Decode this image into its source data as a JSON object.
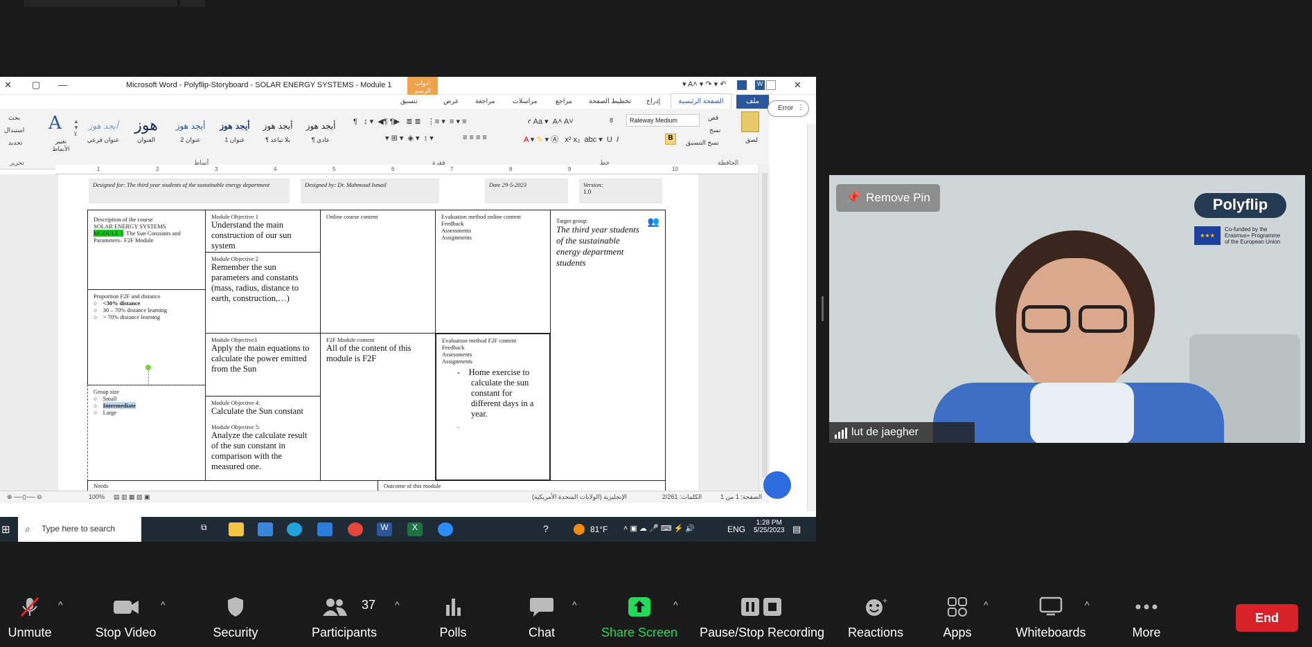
{
  "word": {
    "title": "Microsoft Word - Polyflip-Storyboard - SOLAR ENERGY SYSTEMS - Module 1",
    "tools_tab": "أدوات الرسم",
    "format_tab": "تنسيق",
    "tabs": [
      "ملف",
      "الصفحة الرئيسية",
      "إدراج",
      "تخطيط الصفحة",
      "مراجع",
      "مراسلات",
      "مراجعة",
      "عرض"
    ],
    "error_button": "Error",
    "font_name": "Raleway Medium",
    "font_size": "8",
    "group_labels": {
      "clipboard": "الحافظة",
      "font": "خط",
      "paragraph": "فقرة",
      "styles": "أنماط",
      "editing": "تحرير"
    },
    "clipboard_items": [
      "قص",
      "نسخ",
      "نسخ التنسيق",
      "لصق"
    ],
    "editing_items": [
      "بحث",
      "استبدال",
      "تحديد"
    ],
    "change_styles": "تغيير الأنماط",
    "styles": [
      {
        "sample": "أيجد هوز",
        "name": "¶ عادي"
      },
      {
        "sample": "أيجد هوز",
        "name": "¶ بلا تباعد"
      },
      {
        "sample": "أيجد هوز",
        "name": "عنوان 1"
      },
      {
        "sample": "أيجد هوز",
        "name": "عنوان 2"
      },
      {
        "sample": "هوز",
        "name": "العنوان"
      },
      {
        "sample": "أيجد هوز",
        "name": "عنوان فرعي"
      }
    ],
    "ruler_numbers": [
      "1",
      "2",
      "3",
      "4",
      "5",
      "6",
      "7",
      "8",
      "9",
      "10"
    ],
    "status": {
      "page": "الصفحة: 1 من 1",
      "words": "الكلمات: 2/261",
      "language": "الإنجليزية (الولايات المتحدة الأمريكية)",
      "zoom": "100%"
    }
  },
  "doc": {
    "header": {
      "designed_for": "Designed for: The third year students of the sustainable energy department",
      "designed_by": "Designed by: Dr. Mahmoud Ismail",
      "date": "Date 29-5-2023",
      "version_label": "Version:",
      "version_value": "1.0"
    },
    "description_title": "Description of the course",
    "description_line1": "SOLAR ENERGY SYSTEMS",
    "module_label": "MODULE 1",
    "description_rest": ": The Sun Constants and Parameters– F2F Module",
    "proportion_title": "Proportion F2F and distance",
    "proportion_items": [
      "<30% distance",
      "30 – 70% distance learning",
      "> 70% distance learning"
    ],
    "group_size_title": "Group size",
    "group_size_items": [
      "Small",
      "Intermediate",
      "Large"
    ],
    "objective1_label": "Module Objective 1",
    "objective1": "Understand the main construction of our sun system",
    "objective2_label": "Module Objective 2",
    "objective2": "Remember the sun parameters and constants (mass, radius, distance to earth, construction,…)",
    "objective3_label": "Module Objective3",
    "objective3": "Apply the main equations to calculate the power emitted from the Sun",
    "objective4_label": "Module Objective 4:",
    "objective4": "Calculate the Sun constant",
    "objective5_label": "Module Objective 5:",
    "objective5": "Analyze the calculate result of the sun constant in comparison with the measured one.",
    "online_content": "Online course content",
    "f2f_content_label": "F2F Module content",
    "f2f_content": "All of the content of this module is F2F",
    "eval_online": "Evaluation method online content",
    "eval_online_items": [
      "Feedback",
      "Assessments",
      "Assignments"
    ],
    "eval_f2f": "Evaluation method F2F content",
    "eval_f2f_items": [
      "Feedback",
      "Assessments",
      "Assignments"
    ],
    "home_exercise": "Home exercise to calculate the sun constant for different days in a year.",
    "target_label": "Target group:",
    "target": "The third year students of the sustainable energy department students",
    "needs": "Needs",
    "outcome": "Outcome of this module"
  },
  "taskbar": {
    "search_placeholder": "Type here to search",
    "weather": "81°F",
    "lang": "ENG",
    "time": "1:28 PM",
    "date": "5/25/2023"
  },
  "video": {
    "remove_pin": "Remove Pin",
    "logo": "Polyflip",
    "eu_line1": "Co-funded by the",
    "eu_line2": "Erasmus+ Programme",
    "eu_line3": "of the European Union",
    "participant_name": "lut de jaegher"
  },
  "toolbar": {
    "unmute": "Unmute",
    "stop_video": "Stop Video",
    "security": "Security",
    "participants": "Participants",
    "participants_count": "37",
    "polls": "Polls",
    "chat": "Chat",
    "share_screen": "Share Screen",
    "recording": "Pause/Stop Recording",
    "reactions": "Reactions",
    "apps": "Apps",
    "whiteboards": "Whiteboards",
    "more": "More",
    "end": "End"
  },
  "colors": {
    "share_green": "#23d959",
    "end_red": "#d8222a",
    "word_blue": "#2b579a"
  }
}
